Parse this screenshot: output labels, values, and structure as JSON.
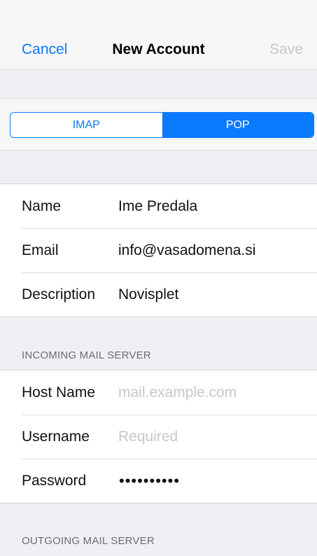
{
  "navbar": {
    "cancel_label": "Cancel",
    "title": "New Account",
    "save_label": "Save"
  },
  "account_type": {
    "options": [
      "IMAP",
      "POP"
    ],
    "selected": "POP"
  },
  "account": {
    "name_label": "Name",
    "name_value": "Ime Predala",
    "email_label": "Email",
    "email_value": "info@vasadomena.si",
    "description_label": "Description",
    "description_value": "Novisplet"
  },
  "incoming": {
    "header": "INCOMING MAIL SERVER",
    "host_label": "Host Name",
    "host_placeholder": "mail.example.com",
    "username_label": "Username",
    "username_placeholder": "Required",
    "password_label": "Password",
    "password_value": "••••••••••"
  },
  "outgoing": {
    "header": "OUTGOING MAIL SERVER"
  },
  "colors": {
    "accent": "#0a7afe",
    "background": "#efeff4",
    "disabled": "#c7c7cc"
  }
}
